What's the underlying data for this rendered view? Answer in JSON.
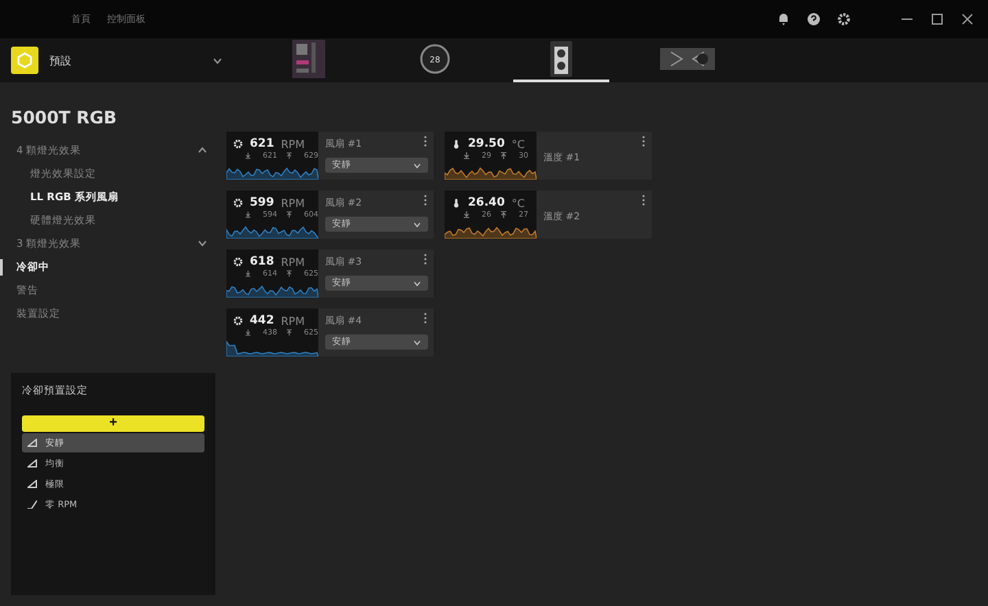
{
  "title_bar": {
    "nav": [
      {
        "label": "首頁",
        "selected": false
      },
      {
        "label": "控制面板",
        "selected": false
      }
    ]
  },
  "profile": {
    "name": "預設"
  },
  "devices": [
    {
      "kind": "motherboard",
      "selected": false
    },
    {
      "kind": "cooler",
      "selected": false,
      "label": "28"
    },
    {
      "kind": "case",
      "selected": true
    },
    {
      "kind": "gpu",
      "selected": false
    }
  ],
  "device_title": "5000T RGB",
  "sidebar": {
    "items": [
      {
        "label": "4 顆燈光效果",
        "selected": false,
        "expanded": true,
        "children": [
          {
            "label": "燈光效果設定",
            "selected": false
          },
          {
            "label": "LL RGB 系列風扇",
            "selected": true
          },
          {
            "label": "硬體燈光效果",
            "selected": false
          }
        ]
      },
      {
        "label": "3 顆燈光效果",
        "selected": false,
        "expanded": false
      },
      {
        "label": "冷卻中",
        "selected": true
      },
      {
        "label": "警告",
        "selected": false
      },
      {
        "label": "裝置設定",
        "selected": false
      }
    ]
  },
  "presets": {
    "title": "冷卻預置設定",
    "add_button": "+",
    "items": [
      {
        "label": "安靜",
        "selected": true,
        "kind": "quiet"
      },
      {
        "label": "均衡",
        "selected": false,
        "kind": "balanced"
      },
      {
        "label": "極限",
        "selected": false,
        "kind": "extreme"
      },
      {
        "label": "零 RPM",
        "selected": false,
        "kind": "zero"
      }
    ]
  },
  "columns": [
    {
      "cards": [
        {
          "kind": "fan",
          "value": "621",
          "unit": "RPM",
          "min": "621",
          "max": "629",
          "name": "風扇 #1",
          "preset": "安靜"
        },
        {
          "kind": "fan",
          "value": "599",
          "unit": "RPM",
          "min": "594",
          "max": "604",
          "name": "風扇 #2",
          "preset": "安靜"
        },
        {
          "kind": "fan",
          "value": "618",
          "unit": "RPM",
          "min": "614",
          "max": "625",
          "name": "風扇 #3",
          "preset": "安靜"
        },
        {
          "kind": "fan",
          "value": "442",
          "unit": "RPM",
          "min": "438",
          "max": "625",
          "name": "風扇 #4",
          "preset": "安靜"
        }
      ]
    },
    {
      "cards": [
        {
          "kind": "temp",
          "value": "29.50",
          "unit": "°C",
          "min": "29",
          "max": "30",
          "name": "溫度 #1"
        },
        {
          "kind": "temp",
          "value": "26.40",
          "unit": "°C",
          "min": "26",
          "max": "27",
          "name": "溫度 #2"
        }
      ]
    }
  ]
}
